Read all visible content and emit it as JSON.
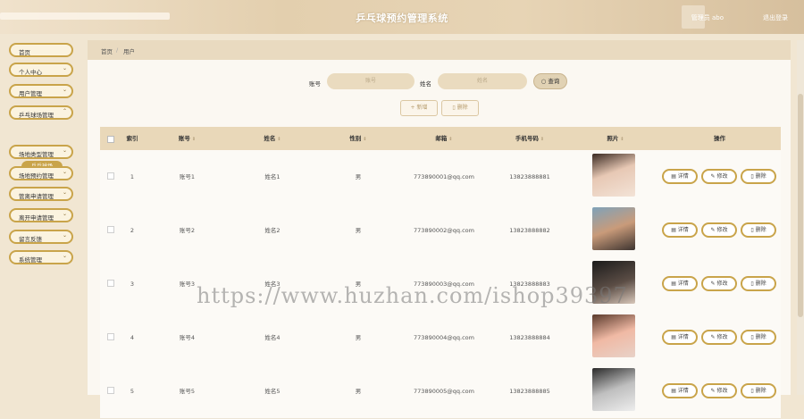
{
  "header": {
    "title": "乒乓球预约管理系统",
    "user": "管理员 abo",
    "logout": "退出登录"
  },
  "sidebar": {
    "items": [
      {
        "label": "首页"
      },
      {
        "label": "个人中心"
      },
      {
        "label": "用户管理"
      },
      {
        "label": "乒乓球场管理"
      },
      {
        "label": "场地类型管理"
      },
      {
        "label": "场地预约管理"
      },
      {
        "label": "管离申请管理"
      },
      {
        "label": "离开申请管理"
      },
      {
        "label": "留言反馈"
      },
      {
        "label": "系统管理"
      }
    ],
    "sub_item": "乒乓球场"
  },
  "breadcrumb": {
    "home": "首页",
    "sep": "/",
    "current": "用户"
  },
  "search": {
    "account_label": "账号",
    "account_placeholder": "账号",
    "name_label": "姓名",
    "name_placeholder": "姓名",
    "query_button": "查询"
  },
  "actions": {
    "add": "+ 新增",
    "delete": "删除"
  },
  "table": {
    "headers": [
      "索引",
      "账号",
      "姓名",
      "性别",
      "邮箱",
      "手机号码",
      "照片",
      "操作"
    ],
    "rows": [
      {
        "index": "1",
        "account": "账号1",
        "name": "姓名1",
        "gender": "男",
        "email": "773890001@qq.com",
        "phone": "13823888881"
      },
      {
        "index": "2",
        "account": "账号2",
        "name": "姓名2",
        "gender": "男",
        "email": "773890002@qq.com",
        "phone": "13823888882"
      },
      {
        "index": "3",
        "account": "账号3",
        "name": "姓名3",
        "gender": "男",
        "email": "773890003@qq.com",
        "phone": "13823888883"
      },
      {
        "index": "4",
        "account": "账号4",
        "name": "姓名4",
        "gender": "男",
        "email": "773890004@qq.com",
        "phone": "13823888884"
      },
      {
        "index": "5",
        "account": "账号5",
        "name": "姓名5",
        "gender": "男",
        "email": "773890005@qq.com",
        "phone": "13823888885"
      }
    ],
    "op_detail": "详情",
    "op_edit": "修改",
    "op_delete": "删除"
  },
  "watermark": "https://www.huzhan.com/ishop39397",
  "colors": {
    "accent": "#c9a44a",
    "header_bg": "#e9d8b9",
    "page_bg": "#f1e6d2"
  }
}
